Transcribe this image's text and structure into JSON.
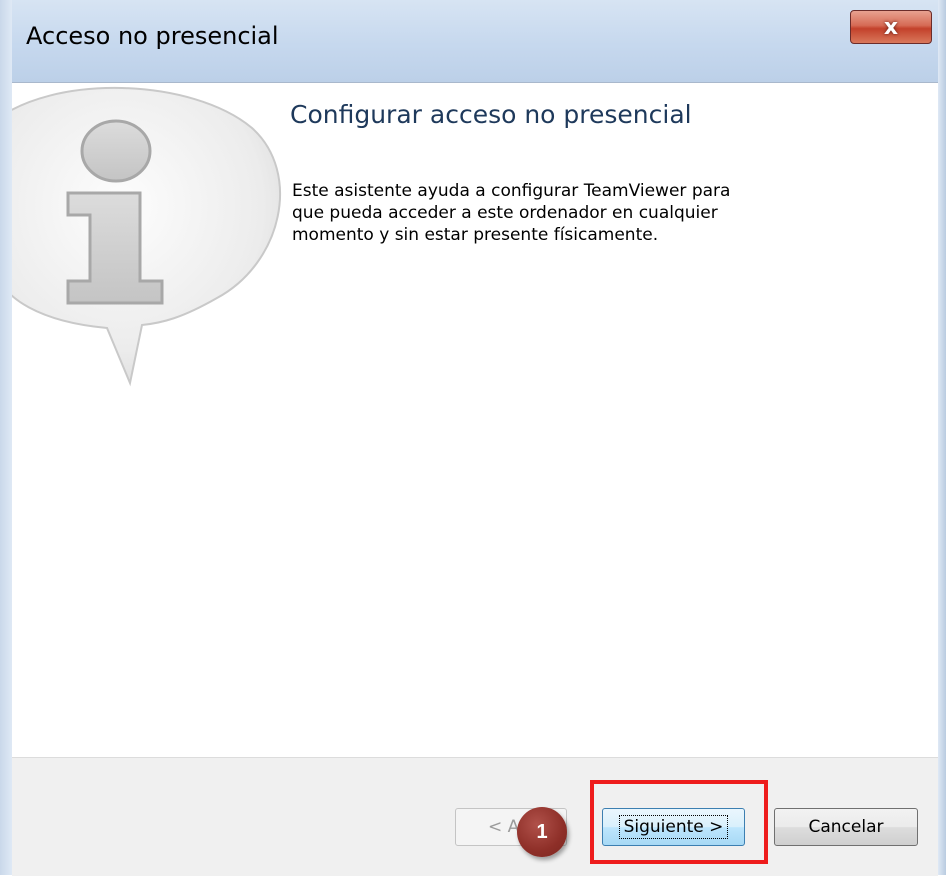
{
  "window": {
    "title": "Acceso no presencial",
    "close_label": "x"
  },
  "content": {
    "heading": "Configurar acceso no presencial",
    "description_lines": [
      "Este asistente ayuda a configurar TeamViewer para",
      "que pueda acceder a este ordenador en cualquier",
      "momento y sin estar presente físicamente."
    ],
    "icon": "info-speech-bubble-icon"
  },
  "buttons": {
    "back_label": "< Atrás",
    "next_label": "Siguiente >",
    "cancel_label": "Cancelar"
  },
  "annotation": {
    "step_number": "1",
    "highlight_color": "#ee1c1c",
    "badge_color": "#8e2f28"
  }
}
